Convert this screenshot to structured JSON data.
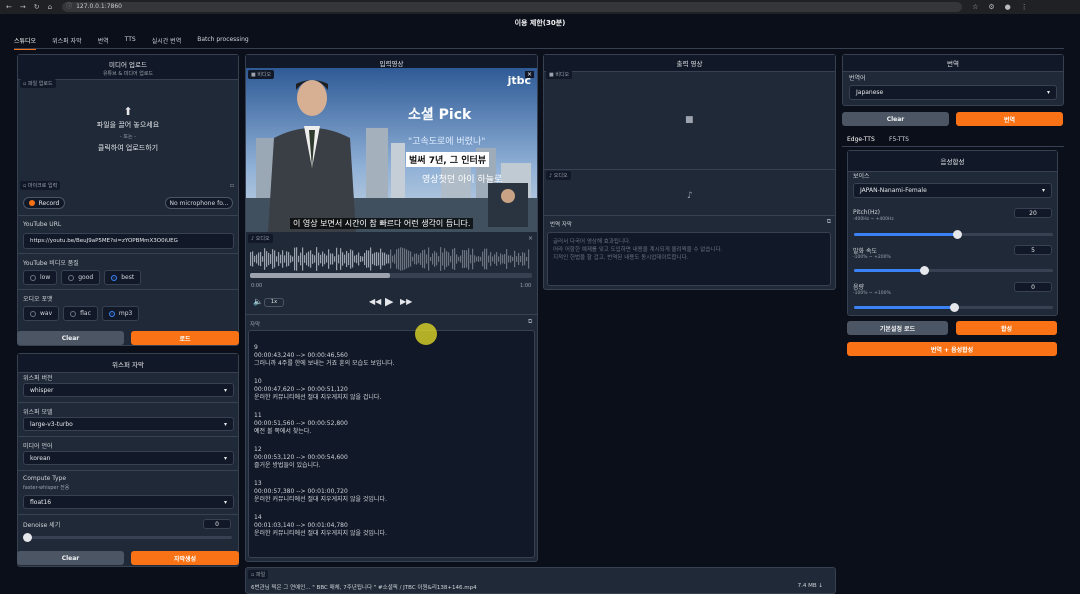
{
  "browser": {
    "url": "127.0.0.1:7860"
  },
  "app": {
    "title": "이용 제한(30분)"
  },
  "tabs": [
    "스튜디오",
    "위스퍼 자막",
    "번역",
    "TTS",
    "실시간 번역",
    "Batch processing"
  ],
  "upload": {
    "title": "미디어 업로드",
    "subtitle": "유튜브 & 미디어 업로드",
    "file_label": "파일 업로드",
    "drop_main": "파일을 끌어 놓으세요",
    "drop_or": "- 또는 -",
    "drop_click": "클릭하여 업로드하기",
    "mic_label": "마이크로 입력",
    "record_label": "Record",
    "mic_select": "No microphone fo..."
  },
  "youtube": {
    "url_label": "YouTube URL",
    "url_value": "https://youtu.be/BeuJ9aP5ME?si=zYOPBMmX3O0iUEG",
    "quality_label": "YouTube 비디오 품질",
    "quality_options": [
      "low",
      "good",
      "best"
    ],
    "quality_selected": "best",
    "audio_label": "오디오 포맷",
    "audio_options": [
      "wav",
      "flac",
      "mp3"
    ],
    "audio_selected": "mp3",
    "clear_label": "Clear",
    "submit_label": "로드"
  },
  "whisper": {
    "title": "위스퍼 자막",
    "version_label": "위스퍼 버전",
    "version_value": "whisper",
    "model_label": "위스퍼 모델",
    "model_value": "large-v3-turbo",
    "lang_label": "미디어 언어",
    "lang_value": "korean",
    "compute_label": "Compute Type",
    "compute_hint": "faster-whisper 전용",
    "compute_value": "float16",
    "denoise_label": "Denoise 세기",
    "denoise_value": "0",
    "clear_label": "Clear",
    "submit_label": "자막생성"
  },
  "input_video": {
    "title": "입력영상",
    "video_label": "비디오",
    "brand": "jtbc",
    "headline": "소셜 Pick",
    "quote": "\"고속도로에 버렸나\"",
    "caption_box": "벌써 7년, 그 인터뷰",
    "caption_tail": "영상첫던 아이 하늘로",
    "subtitle_bar": "이 영상 보면서 시간이 참 빠르다 어런 생각이 듭니다."
  },
  "audio": {
    "label": "오디오",
    "time_start": "0:00",
    "time_end": "1:00",
    "speed": "1x"
  },
  "subtitles": {
    "label": "자막",
    "entries": [
      {
        "idx": "9",
        "time": "00:00:43,240 --> 00:00:46,560",
        "text": "그러니까 4주를 한에 보내는 거죠 훈의 모습도 보입니다."
      },
      {
        "idx": "10",
        "time": "00:00:47,620 --> 00:00:51,120",
        "text": "운러한 커뮤니티에선 절대 지우게지지 않을 겁니다."
      },
      {
        "idx": "11",
        "time": "00:00:51,560 --> 00:00:52,800",
        "text": "예전 볼 쪽에서 찾는다."
      },
      {
        "idx": "12",
        "time": "00:00:53,120 --> 00:00:54,600",
        "text": "즐거운 방법들이 있습니다."
      },
      {
        "idx": "13",
        "time": "00:00:57,380 --> 00:01:00,720",
        "text": "운러한 커뮤니티에선 절대 지우게지지 않을 것입니다."
      },
      {
        "idx": "14",
        "time": "00:01:03,140 --> 00:01:04,780",
        "text": "운러한 커뮤니티에선 절대 지우게지지 않을 것입니다."
      }
    ]
  },
  "file": {
    "label": "파일",
    "name": "6번관님 찍은 그 연예인... \" BBC 매체, 7주년됩니다 \" #소셜픽 / JTBC 이원&리138+146.mp4",
    "size": "7.4 MB ↓"
  },
  "output": {
    "title": "출력 영상",
    "video_label": "비디오",
    "audio_label": "오디오",
    "trans_label": "번역 자막",
    "trans_lines": [
      "글러서 다국어 영상해 효과됩니다.",
      "어라 어항한 예제를 잊고 도입하면 내용을 계시되게 올려찍을 수 없습니다.",
      "지적인 헌법을 할 겁고, 번역된 내용도 동시업데이트합니다."
    ]
  },
  "translate": {
    "title": "번역",
    "lang_label": "번역어",
    "lang_value": "Japanese",
    "clear_label": "Clear",
    "submit_label": "번역",
    "tts_tabs": [
      "Edge-TTS",
      "F5-TTS"
    ],
    "tts_title": "음성합성",
    "voice_label": "보이스",
    "voice_value": "JAPAN-Nanami-Female",
    "pitch_label": "Pitch(Hz)",
    "pitch_range": "-400Hz ~ +400Hz",
    "pitch_value": "20",
    "pitch_frac": 0.52,
    "rate_label": "발화 속도",
    "rate_range": "-100% ~ +200%",
    "rate_value": "5",
    "rate_frac": 0.35,
    "vol_label": "음량",
    "vol_range": "-100% ~ +100%",
    "vol_value": "0",
    "vol_frac": 0.5,
    "reset_label": "기본설정 로드",
    "synth_label": "합성",
    "full_label": "번역 + 음성합성"
  },
  "colors": {
    "accent": "#f97316",
    "bg": "#0b0f19",
    "panel": "#1f2937",
    "blue": "#3b82f6"
  }
}
